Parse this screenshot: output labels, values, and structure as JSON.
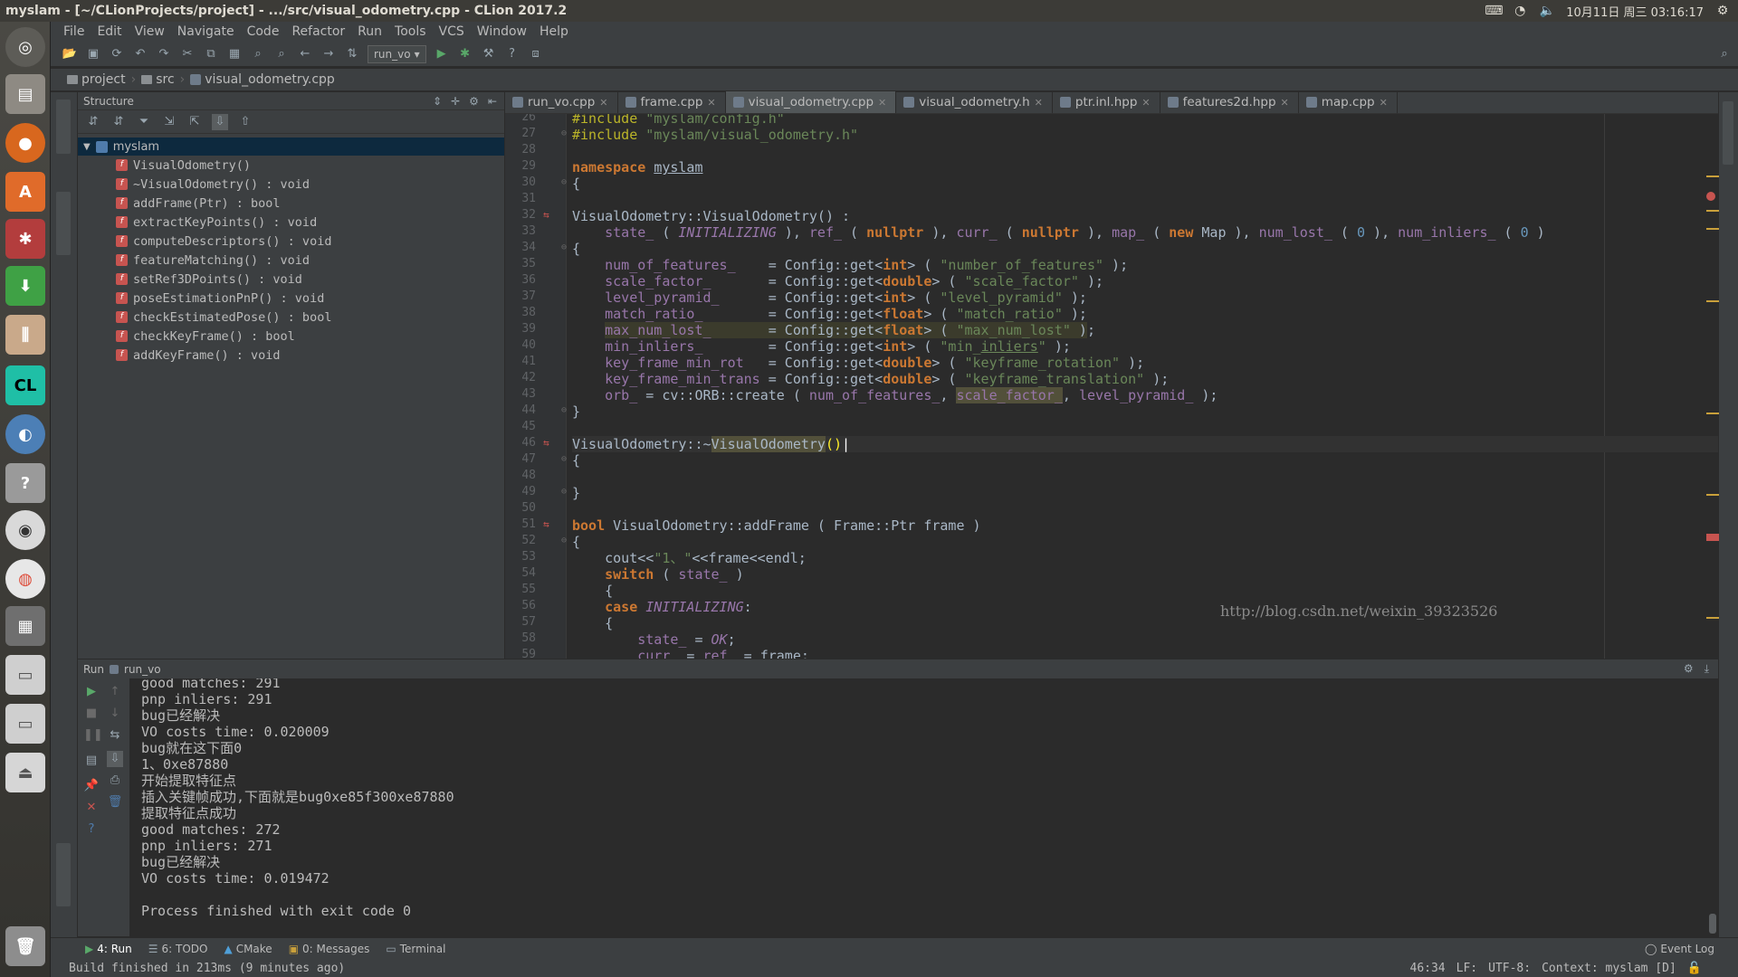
{
  "window": {
    "title": "myslam - [~/CLionProjects/project] - .../src/visual_odometry.cpp - CLion 2017.2",
    "clock": "10月11日 周三 03:16:17"
  },
  "menu": [
    "File",
    "Edit",
    "View",
    "Navigate",
    "Code",
    "Refactor",
    "Run",
    "Tools",
    "VCS",
    "Window",
    "Help"
  ],
  "toolbar": {
    "run_config": "run_vo"
  },
  "breadcrumb": [
    "project",
    "src",
    "visual_odometry.cpp"
  ],
  "structure": {
    "title": "Structure",
    "root": "myslam",
    "items": [
      "VisualOdometry()",
      "~VisualOdometry() : void",
      "addFrame(Ptr) : bool",
      "extractKeyPoints() : void",
      "computeDescriptors() : void",
      "featureMatching() : void",
      "setRef3DPoints() : void",
      "poseEstimationPnP() : void",
      "checkEstimatedPose() : bool",
      "checkKeyFrame() : bool",
      "addKeyFrame() : void"
    ]
  },
  "tabs": [
    {
      "label": "run_vo.cpp"
    },
    {
      "label": "frame.cpp"
    },
    {
      "label": "visual_odometry.cpp",
      "active": true
    },
    {
      "label": "visual_odometry.h"
    },
    {
      "label": "ptr.inl.hpp"
    },
    {
      "label": "features2d.hpp"
    },
    {
      "label": "map.cpp"
    }
  ],
  "editor": {
    "line_numbers": [
      "26",
      "27",
      "28",
      "29",
      "30",
      "31",
      "32",
      "33",
      "34",
      "35",
      "36",
      "37",
      "38",
      "39",
      "40",
      "41",
      "42",
      "43",
      "44",
      "45",
      "46",
      "47",
      "48",
      "49",
      "50",
      "51",
      "52",
      "53",
      "54",
      "55",
      "56",
      "57",
      "58",
      "59"
    ],
    "watermark": "http://blog.csdn.net/weixin_39323526"
  },
  "run": {
    "header_label": "Run",
    "config": "run_vo",
    "console": [
      "good matches: 291",
      "pnp inliers: 291",
      "bug已经解决",
      "VO costs time: 0.020009",
      "bug就在这下面0",
      "1、0xe87880",
      "开始提取特征点",
      "插入关键帧成功,下面就是bug0xe85f300xe87880",
      "提取特征点成功",
      "good matches: 272",
      "pnp inliers: 271",
      "bug已经解决",
      "VO costs time: 0.019472",
      "",
      "Process finished with exit code 0"
    ]
  },
  "bottom_tools": [
    {
      "label": "4: Run",
      "active": true
    },
    {
      "label": "6: TODO"
    },
    {
      "label": "CMake"
    },
    {
      "label": "0: Messages"
    },
    {
      "label": "Terminal"
    }
  ],
  "event_log": "Event Log",
  "status": {
    "message": "Build finished in 213ms (9 minutes ago)",
    "position": "46:34",
    "line_sep": "LF:",
    "encoding": "UTF-8:",
    "context": "Context: myslam [D]"
  },
  "colors": {
    "bg": "#2b2b2b",
    "panel": "#3c3f41",
    "keyword": "#cc7832",
    "string": "#6a8759",
    "number": "#6897bb",
    "field": "#9876aa",
    "selection": "#0d293e"
  }
}
